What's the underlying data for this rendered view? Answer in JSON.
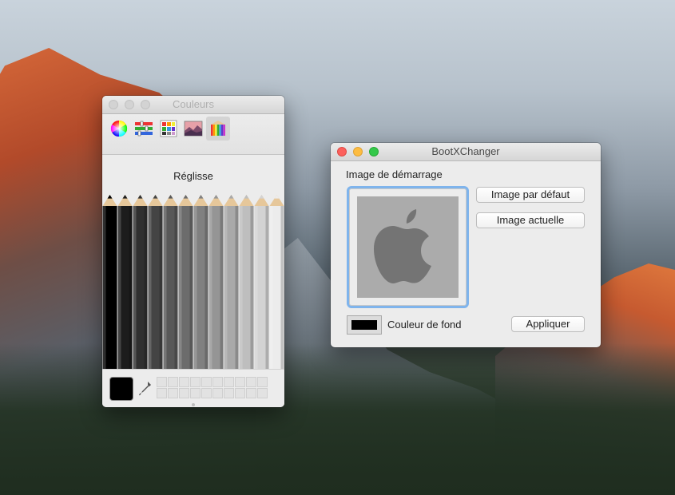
{
  "colors_panel": {
    "title": "Couleurs",
    "tabs": [
      {
        "name": "color-wheel",
        "icon": "color-wheel-icon"
      },
      {
        "name": "color-sliders",
        "icon": "sliders-icon"
      },
      {
        "name": "color-palettes",
        "icon": "palette-icon"
      },
      {
        "name": "image-palettes",
        "icon": "image-palette-icon"
      },
      {
        "name": "pencils",
        "icon": "pencils-icon",
        "selected": true
      }
    ],
    "selected_color_name": "Réglisse",
    "selected_color": "#000000",
    "pencil_rows": [
      [
        "#000000",
        "#1c1c1c",
        "#303030",
        "#444444",
        "#585858",
        "#6c6c6c",
        "#808080",
        "#959595",
        "#a9a9a9",
        "#bebebe",
        "#d3d3d3",
        "#ececec"
      ],
      [
        "#7a1010",
        "#7a3a10",
        "#6e6e10",
        "#4a6e10",
        "#106e10",
        "#106e3a",
        "#106e6e",
        "#10406e",
        "#10106e",
        "#3a106e",
        "#6e106e",
        "#6e1040"
      ],
      [
        "#c21818",
        "#c66a18",
        "#c8c818",
        "#82c818",
        "#18c818",
        "#18c86a",
        "#18c8c8",
        "#1870c8",
        "#1818c8",
        "#7018c8",
        "#c818c8",
        "#c81870"
      ],
      [
        "#e84848",
        "#eea050",
        "#f2f24e",
        "#b6f250",
        "#50f250",
        "#50f2a2",
        "#50f2f2",
        "#50a6f2",
        "#5050f2",
        "#a050f2",
        "#f250f2",
        "#f25099"
      ],
      [
        "#e07a78",
        "#ecc08a",
        "#f2f28e",
        "#d2f28c",
        "#8ef28e",
        "#8ef2c6",
        "#8ef2f2",
        "#8cc4f2",
        "#8c8cf2",
        "#c08cf2",
        "#f28cf2",
        "#f28cc6"
      ]
    ]
  },
  "bootx": {
    "title": "BootXChanger",
    "image_label": "Image de démarrage",
    "default_image_button": "Image par défaut",
    "current_image_button": "Image actuelle",
    "background_label": "Couleur de fond",
    "background_color": "#000000",
    "apply_button": "Appliquer",
    "preview_background": "#ababab",
    "logo": "apple-logo-icon"
  }
}
